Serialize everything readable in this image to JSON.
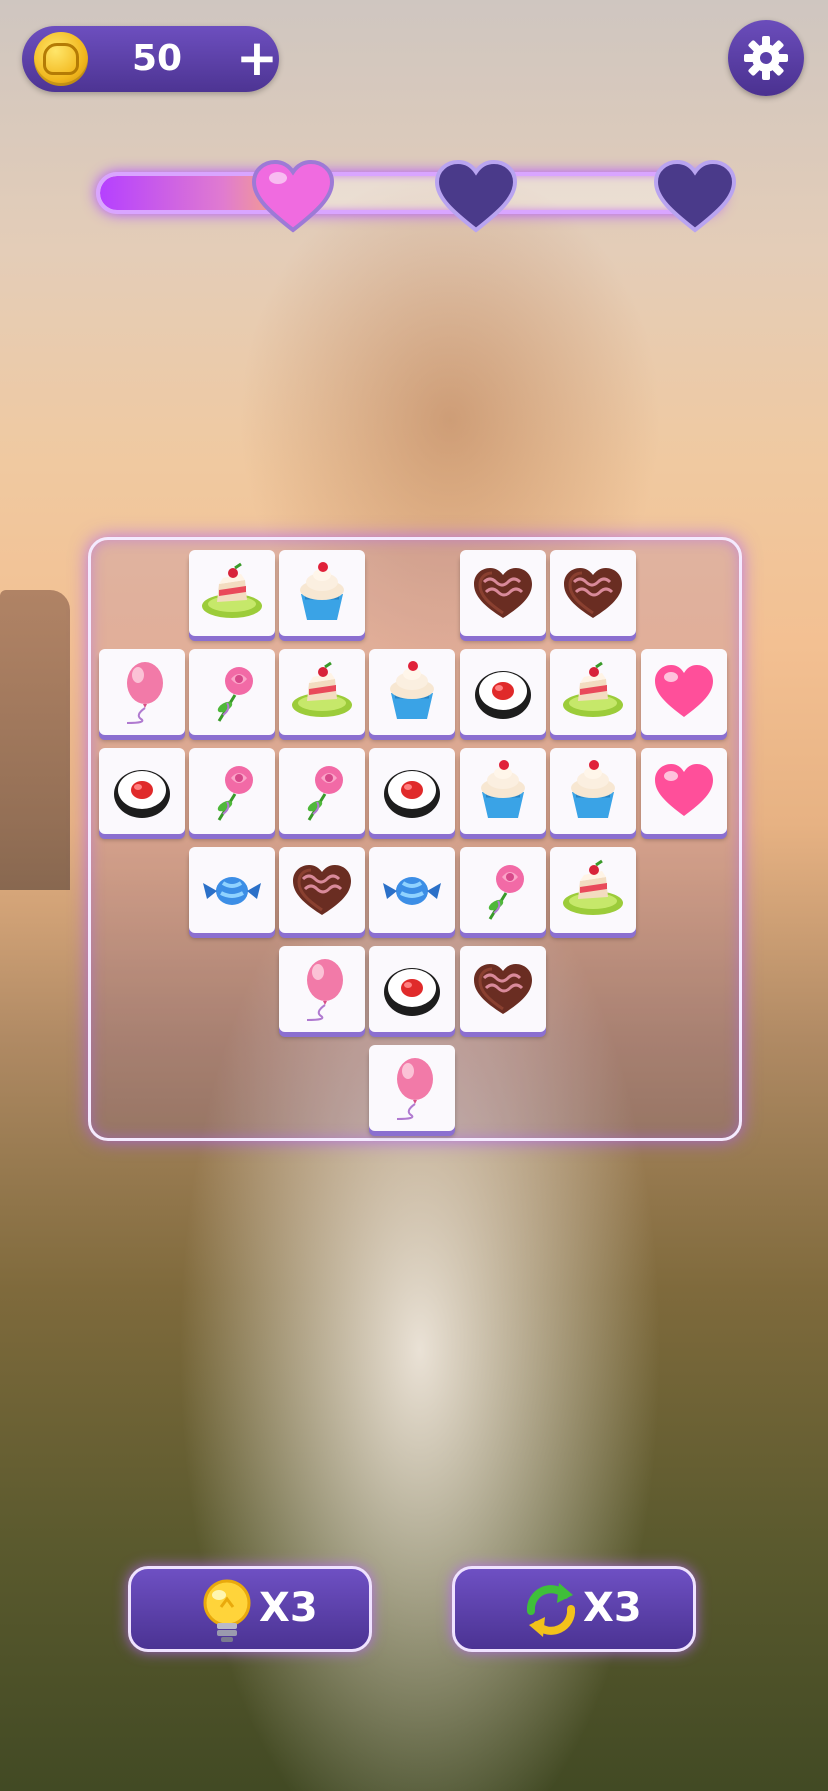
{
  "hud": {
    "coins": "50",
    "coin_icon": "gold-coin-icon",
    "add_coins_symbol": "+",
    "settings_icon": "gear-icon"
  },
  "progress": {
    "fraction": 0.33,
    "milestones": [
      {
        "icon": "heart-icon",
        "achieved": true
      },
      {
        "icon": "heart-icon",
        "achieved": false
      },
      {
        "icon": "heart-icon",
        "achieved": false
      }
    ]
  },
  "board": {
    "layout_rows": [
      [
        null,
        "cake",
        "cupcake",
        null,
        "chocolate",
        "chocolate",
        null
      ],
      [
        "balloon",
        "rose",
        "cake",
        "cupcake",
        "sushi",
        "cake",
        "heart"
      ],
      [
        "sushi",
        "rose",
        "rose",
        "sushi",
        "cupcake",
        "cupcake",
        "heart"
      ],
      [
        null,
        "candy",
        "chocolate",
        "candy",
        "rose",
        "cake",
        null
      ],
      [
        null,
        null,
        "balloon",
        "sushi",
        "chocolate",
        null,
        null
      ],
      [
        null,
        null,
        null,
        "balloon",
        null,
        null,
        null
      ]
    ]
  },
  "boosters": {
    "hint": {
      "label": "X3",
      "icon": "lightbulb-icon"
    },
    "shuffle": {
      "label": "X3",
      "icon": "shuffle-arrows-icon"
    }
  },
  "colors": {
    "panel_purple": "#5a3fa8",
    "glow": "#b052ff",
    "tile_shadow": "#8b6fd0"
  }
}
